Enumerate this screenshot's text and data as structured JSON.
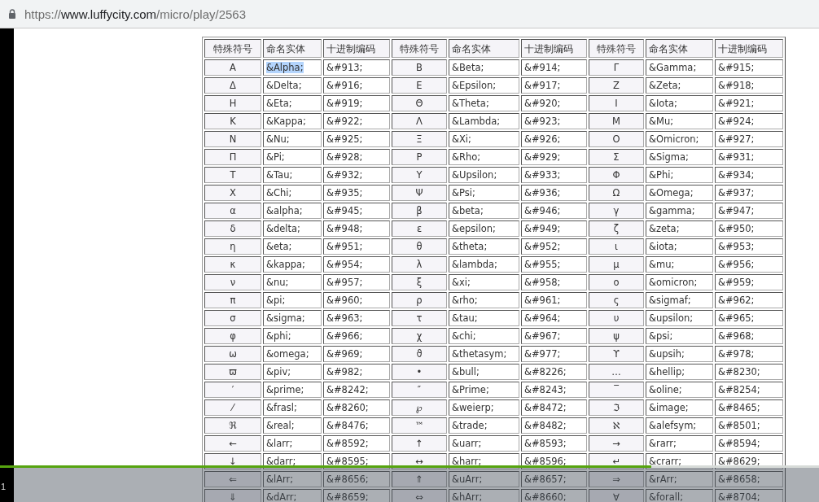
{
  "address_bar": {
    "scheme": "https://",
    "host": "www.luffycity.com",
    "path": "/micro/play/2563"
  },
  "table": {
    "columns": [
      "特殊符号",
      "命名实体",
      "十进制编码",
      "特殊符号",
      "命名实体",
      "十进制编码",
      "特殊符号",
      "命名实体",
      "十进制编码"
    ],
    "rows": [
      [
        {
          "symbol": "Α",
          "entity": "&Alpha;",
          "code": "&#913;",
          "entity_selected": true
        },
        {
          "symbol": "Β",
          "entity": "&Beta;",
          "code": "&#914;",
          "entity_selected": false
        },
        {
          "symbol": "Γ",
          "entity": "&Gamma;",
          "code": "&#915;",
          "entity_selected": false
        }
      ],
      [
        {
          "symbol": "Δ",
          "entity": "&Delta;",
          "code": "&#916;",
          "entity_selected": false
        },
        {
          "symbol": "Ε",
          "entity": "&Epsilon;",
          "code": "&#917;",
          "entity_selected": false
        },
        {
          "symbol": "Ζ",
          "entity": "&Zeta;",
          "code": "&#918;",
          "entity_selected": false
        }
      ],
      [
        {
          "symbol": "Η",
          "entity": "&Eta;",
          "code": "&#919;",
          "entity_selected": false
        },
        {
          "symbol": "Θ",
          "entity": "&Theta;",
          "code": "&#920;",
          "entity_selected": false
        },
        {
          "symbol": "Ι",
          "entity": "&Iota;",
          "code": "&#921;",
          "entity_selected": false
        }
      ],
      [
        {
          "symbol": "Κ",
          "entity": "&Kappa;",
          "code": "&#922;",
          "entity_selected": false
        },
        {
          "symbol": "Λ",
          "entity": "&Lambda;",
          "code": "&#923;",
          "entity_selected": false
        },
        {
          "symbol": "Μ",
          "entity": "&Mu;",
          "code": "&#924;",
          "entity_selected": false
        }
      ],
      [
        {
          "symbol": "Ν",
          "entity": "&Nu;",
          "code": "&#925;",
          "entity_selected": false
        },
        {
          "symbol": "Ξ",
          "entity": "&Xi;",
          "code": "&#926;",
          "entity_selected": false
        },
        {
          "symbol": "Ο",
          "entity": "&Omicron;",
          "code": "&#927;",
          "entity_selected": false
        }
      ],
      [
        {
          "symbol": "Π",
          "entity": "&Pi;",
          "code": "&#928;",
          "entity_selected": false
        },
        {
          "symbol": "Ρ",
          "entity": "&Rho;",
          "code": "&#929;",
          "entity_selected": false
        },
        {
          "symbol": "Σ",
          "entity": "&Sigma;",
          "code": "&#931;",
          "entity_selected": false
        }
      ],
      [
        {
          "symbol": "Τ",
          "entity": "&Tau;",
          "code": "&#932;",
          "entity_selected": false
        },
        {
          "symbol": "Υ",
          "entity": "&Upsilon;",
          "code": "&#933;",
          "entity_selected": false
        },
        {
          "symbol": "Φ",
          "entity": "&Phi;",
          "code": "&#934;",
          "entity_selected": false
        }
      ],
      [
        {
          "symbol": "Χ",
          "entity": "&Chi;",
          "code": "&#935;",
          "entity_selected": false
        },
        {
          "symbol": "Ψ",
          "entity": "&Psi;",
          "code": "&#936;",
          "entity_selected": false
        },
        {
          "symbol": "Ω",
          "entity": "&Omega;",
          "code": "&#937;",
          "entity_selected": false
        }
      ],
      [
        {
          "symbol": "α",
          "entity": "&alpha;",
          "code": "&#945;",
          "entity_selected": false
        },
        {
          "symbol": "β",
          "entity": "&beta;",
          "code": "&#946;",
          "entity_selected": false
        },
        {
          "symbol": "γ",
          "entity": "&gamma;",
          "code": "&#947;",
          "entity_selected": false
        }
      ],
      [
        {
          "symbol": "δ",
          "entity": "&delta;",
          "code": "&#948;",
          "entity_selected": false
        },
        {
          "symbol": "ε",
          "entity": "&epsilon;",
          "code": "&#949;",
          "entity_selected": false
        },
        {
          "symbol": "ζ",
          "entity": "&zeta;",
          "code": "&#950;",
          "entity_selected": false
        }
      ],
      [
        {
          "symbol": "η",
          "entity": "&eta;",
          "code": "&#951;",
          "entity_selected": false
        },
        {
          "symbol": "θ",
          "entity": "&theta;",
          "code": "&#952;",
          "entity_selected": false
        },
        {
          "symbol": "ι",
          "entity": "&iota;",
          "code": "&#953;",
          "entity_selected": false
        }
      ],
      [
        {
          "symbol": "κ",
          "entity": "&kappa;",
          "code": "&#954;",
          "entity_selected": false
        },
        {
          "symbol": "λ",
          "entity": "&lambda;",
          "code": "&#955;",
          "entity_selected": false
        },
        {
          "symbol": "μ",
          "entity": "&mu;",
          "code": "&#956;",
          "entity_selected": false
        }
      ],
      [
        {
          "symbol": "ν",
          "entity": "&nu;",
          "code": "&#957;",
          "entity_selected": false
        },
        {
          "symbol": "ξ",
          "entity": "&xi;",
          "code": "&#958;",
          "entity_selected": false
        },
        {
          "symbol": "ο",
          "entity": "&omicron;",
          "code": "&#959;",
          "entity_selected": false
        }
      ],
      [
        {
          "symbol": "π",
          "entity": "&pi;",
          "code": "&#960;",
          "entity_selected": false
        },
        {
          "symbol": "ρ",
          "entity": "&rho;",
          "code": "&#961;",
          "entity_selected": false
        },
        {
          "symbol": "ς",
          "entity": "&sigmaf;",
          "code": "&#962;",
          "entity_selected": false
        }
      ],
      [
        {
          "symbol": "σ",
          "entity": "&sigma;",
          "code": "&#963;",
          "entity_selected": false
        },
        {
          "symbol": "τ",
          "entity": "&tau;",
          "code": "&#964;",
          "entity_selected": false
        },
        {
          "symbol": "υ",
          "entity": "&upsilon;",
          "code": "&#965;",
          "entity_selected": false
        }
      ],
      [
        {
          "symbol": "φ",
          "entity": "&phi;",
          "code": "&#966;",
          "entity_selected": false
        },
        {
          "symbol": "χ",
          "entity": "&chi;",
          "code": "&#967;",
          "entity_selected": false
        },
        {
          "symbol": "ψ",
          "entity": "&psi;",
          "code": "&#968;",
          "entity_selected": false
        }
      ],
      [
        {
          "symbol": "ω",
          "entity": "&omega;",
          "code": "&#969;",
          "entity_selected": false
        },
        {
          "symbol": "ϑ",
          "entity": "&thetasym;",
          "code": "&#977;",
          "entity_selected": false
        },
        {
          "symbol": "ϒ",
          "entity": "&upsih;",
          "code": "&#978;",
          "entity_selected": false
        }
      ],
      [
        {
          "symbol": "ϖ",
          "entity": "&piv;",
          "code": "&#982;",
          "entity_selected": false
        },
        {
          "symbol": "•",
          "entity": "&bull;",
          "code": "&#8226;",
          "entity_selected": false
        },
        {
          "symbol": "…",
          "entity": "&hellip;",
          "code": "&#8230;",
          "entity_selected": false
        }
      ],
      [
        {
          "symbol": "′",
          "entity": "&prime;",
          "code": "&#8242;",
          "entity_selected": false
        },
        {
          "symbol": "″",
          "entity": "&Prime;",
          "code": "&#8243;",
          "entity_selected": false
        },
        {
          "symbol": "‾",
          "entity": "&oline;",
          "code": "&#8254;",
          "entity_selected": false
        }
      ],
      [
        {
          "symbol": "⁄",
          "entity": "&frasl;",
          "code": "&#8260;",
          "entity_selected": false
        },
        {
          "symbol": "℘",
          "entity": "&weierp;",
          "code": "&#8472;",
          "entity_selected": false
        },
        {
          "symbol": "ℑ",
          "entity": "&image;",
          "code": "&#8465;",
          "entity_selected": false
        }
      ],
      [
        {
          "symbol": "ℜ",
          "entity": "&real;",
          "code": "&#8476;",
          "entity_selected": false
        },
        {
          "symbol": "™",
          "entity": "&trade;",
          "code": "&#8482;",
          "entity_selected": false
        },
        {
          "symbol": "ℵ",
          "entity": "&alefsym;",
          "code": "&#8501;",
          "entity_selected": false
        }
      ],
      [
        {
          "symbol": "←",
          "entity": "&larr;",
          "code": "&#8592;",
          "entity_selected": false
        },
        {
          "symbol": "↑",
          "entity": "&uarr;",
          "code": "&#8593;",
          "entity_selected": false
        },
        {
          "symbol": "→",
          "entity": "&rarr;",
          "code": "&#8594;",
          "entity_selected": false
        }
      ],
      [
        {
          "symbol": "↓",
          "entity": "&darr;",
          "code": "&#8595;",
          "entity_selected": false
        },
        {
          "symbol": "↔",
          "entity": "&harr;",
          "code": "&#8596;",
          "entity_selected": false
        },
        {
          "symbol": "↵",
          "entity": "&crarr;",
          "code": "&#8629;",
          "entity_selected": false
        }
      ],
      [
        {
          "symbol": "⇐",
          "entity": "&lArr;",
          "code": "&#8656;",
          "entity_selected": false
        },
        {
          "symbol": "⇑",
          "entity": "&uArr;",
          "code": "&#8657;",
          "entity_selected": false
        },
        {
          "symbol": "⇒",
          "entity": "&rArr;",
          "code": "&#8658;",
          "entity_selected": false
        }
      ],
      [
        {
          "symbol": "⇓",
          "entity": "&dArr;",
          "code": "&#8659;",
          "entity_selected": false
        },
        {
          "symbol": "⇔",
          "entity": "&hArr;",
          "code": "&#8660;",
          "entity_selected": false
        },
        {
          "symbol": "∀",
          "entity": "&forall;",
          "code": "&#8704;",
          "entity_selected": false
        }
      ]
    ]
  },
  "player": {
    "progress": {
      "level": 0.795
    },
    "counter": "1"
  }
}
